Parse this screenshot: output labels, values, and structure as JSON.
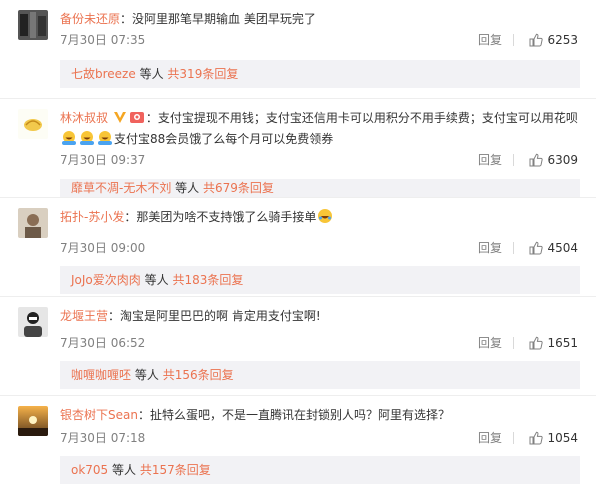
{
  "comments": [
    {
      "user": "备份未还原",
      "text": "没阿里那笔早期输血  美团早玩完了",
      "time": "7月30日 07:35",
      "reply_label": "回复",
      "likes": "6253",
      "sub_user": "七故breeze",
      "sub_mid": "等人",
      "sub_count": "共319条回复"
    },
    {
      "user": "林沐叔叔",
      "text": "支付宝提现不用钱；支付宝还信用卡可以用积分不用手续费；支付宝可以用花呗",
      "text2": "支付宝88会员饿了么每个月可以免费领券",
      "time": "7月30日 09:37",
      "reply_label": "回复",
      "likes": "6309",
      "sub_user": "靡草不凋-无木不刘",
      "sub_mid": "等人",
      "sub_count": "共679条回复"
    },
    {
      "user": "拓扑-苏小发",
      "text": "那美团为啥不支持饿了么骑手接单",
      "time": "7月30日 09:00",
      "reply_label": "回复",
      "likes": "4504",
      "sub_user": "JoJo爱次肉肉",
      "sub_mid": "等人",
      "sub_count": "共183条回复"
    },
    {
      "user": "龙堰王营",
      "text": "淘宝是阿里巴巴的啊  肯定用支付宝啊!",
      "time": "7月30日 06:52",
      "reply_label": "回复",
      "likes": "1651",
      "sub_user": "咖喱咖喱呸",
      "sub_mid": "等人",
      "sub_count": "共156条回复"
    },
    {
      "user": "银杏树下Sean",
      "text": "扯特么蛋吧，不是一直腾讯在封锁别人吗？阿里有选择？",
      "time": "7月30日 07:18",
      "reply_label": "回复",
      "likes": "1054",
      "sub_user": "ok705",
      "sub_mid": "等人",
      "sub_count": "共157条回复"
    }
  ],
  "colors": {
    "username": "#eb7350",
    "subbar_bg": "#f2f2f5",
    "meta": "#808080"
  },
  "icons": [
    "avatar",
    "verified-badge",
    "fan-badge",
    "laughing-emoji",
    "thumbs-up-icon"
  ]
}
